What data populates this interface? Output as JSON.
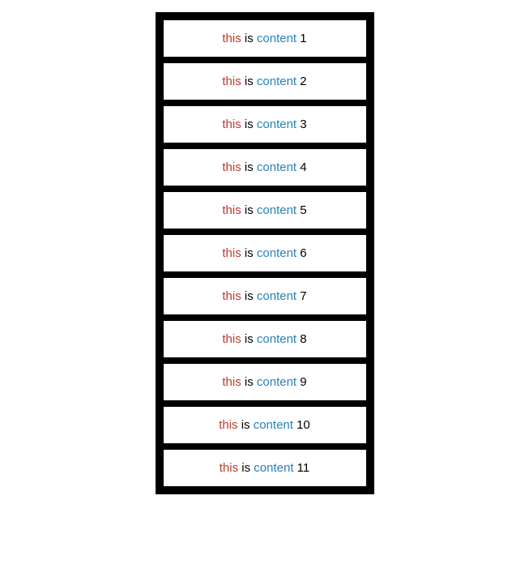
{
  "items": [
    {
      "id": 1,
      "label": "this is content 1"
    },
    {
      "id": 2,
      "label": "this is content 2"
    },
    {
      "id": 3,
      "label": "this is content 3"
    },
    {
      "id": 4,
      "label": "this is content 4"
    },
    {
      "id": 5,
      "label": "this is content 5"
    },
    {
      "id": 6,
      "label": "this is content 6"
    },
    {
      "id": 7,
      "label": "this is content 7"
    },
    {
      "id": 8,
      "label": "this is content 8"
    },
    {
      "id": 9,
      "label": "this is content 9"
    },
    {
      "id": 10,
      "label": "this is content 10"
    },
    {
      "id": 11,
      "label": "this is content 11"
    }
  ]
}
